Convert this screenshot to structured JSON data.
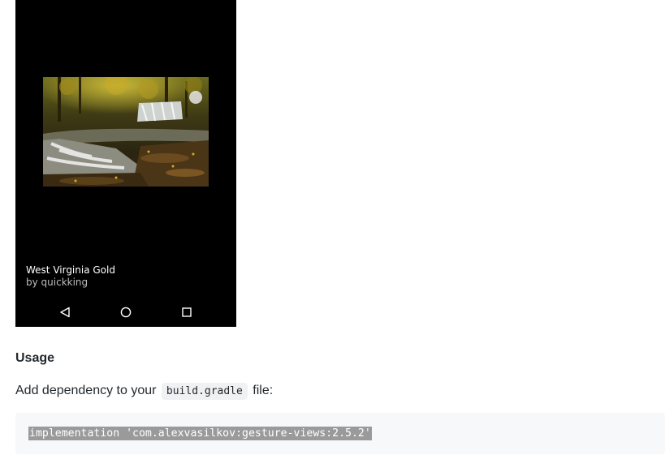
{
  "phone": {
    "photo": {
      "title": "West Virginia Gold",
      "author": "by quickking"
    },
    "navbar": {
      "back_icon": "back-triangle-icon",
      "home_icon": "home-circle-icon",
      "recent_icon": "recent-square-icon"
    }
  },
  "content": {
    "usage_heading": "Usage",
    "dependency_text_before": "Add dependency to your ",
    "dependency_code": "build.gradle",
    "dependency_text_after": " file:",
    "code_block": "implementation 'com.alexvasilkov:gesture-views:2.5.2'"
  }
}
